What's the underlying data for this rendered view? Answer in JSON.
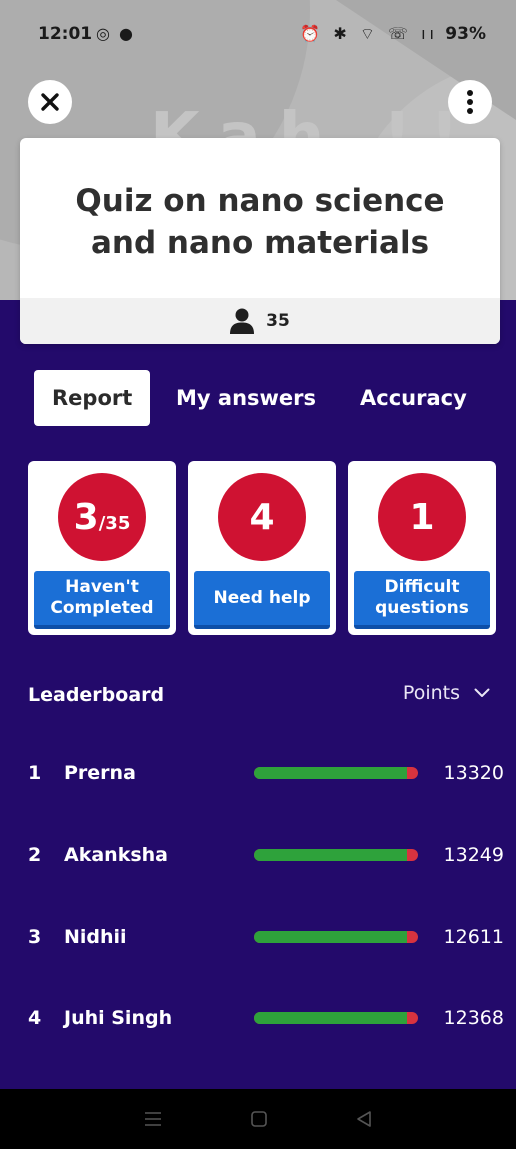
{
  "status_bar": {
    "time": "12:01",
    "left_icons": "◎ ●",
    "right_icons": "⏰ ✱ ⌔ ☏ ıı",
    "battery": "93%"
  },
  "header": {
    "close_icon": "close-icon",
    "more_icon": "more-vertical-icon",
    "watermark": "Kah  !!"
  },
  "quiz": {
    "title": "Quiz on nano science and nano materials",
    "participants": "35",
    "participants_icon": "person-icon"
  },
  "tabs": [
    {
      "label": "Report",
      "active": true
    },
    {
      "label": "My answers",
      "active": false
    },
    {
      "label": "Accuracy",
      "active": false
    }
  ],
  "stats": [
    {
      "value": "3",
      "suffix": "/35",
      "label": "Haven't Completed"
    },
    {
      "value": "4",
      "suffix": "",
      "label": "Need help"
    },
    {
      "value": "1",
      "suffix": "",
      "label": "Difficult questions"
    }
  ],
  "leaderboard": {
    "title": "Leaderboard",
    "sort_label": "Points",
    "rows": [
      {
        "rank": "1",
        "name": "Prerna",
        "score": "13320",
        "correct_fraction": 0.93
      },
      {
        "rank": "2",
        "name": "Akanksha",
        "score": "13249",
        "correct_fraction": 0.93
      },
      {
        "rank": "3",
        "name": "Nidhii",
        "score": "12611",
        "correct_fraction": 0.93
      },
      {
        "rank": "4",
        "name": "Juhi Singh",
        "score": "12368",
        "correct_fraction": 0.93
      }
    ]
  },
  "colors": {
    "background": "#230a6b",
    "accent_red": "#cf1232",
    "button_blue": "#1b6fd6",
    "bar_green": "#2ea23b",
    "bar_red": "#d8333f"
  },
  "nav": {
    "icons": [
      "recent-apps-icon",
      "home-icon",
      "back-icon"
    ]
  }
}
